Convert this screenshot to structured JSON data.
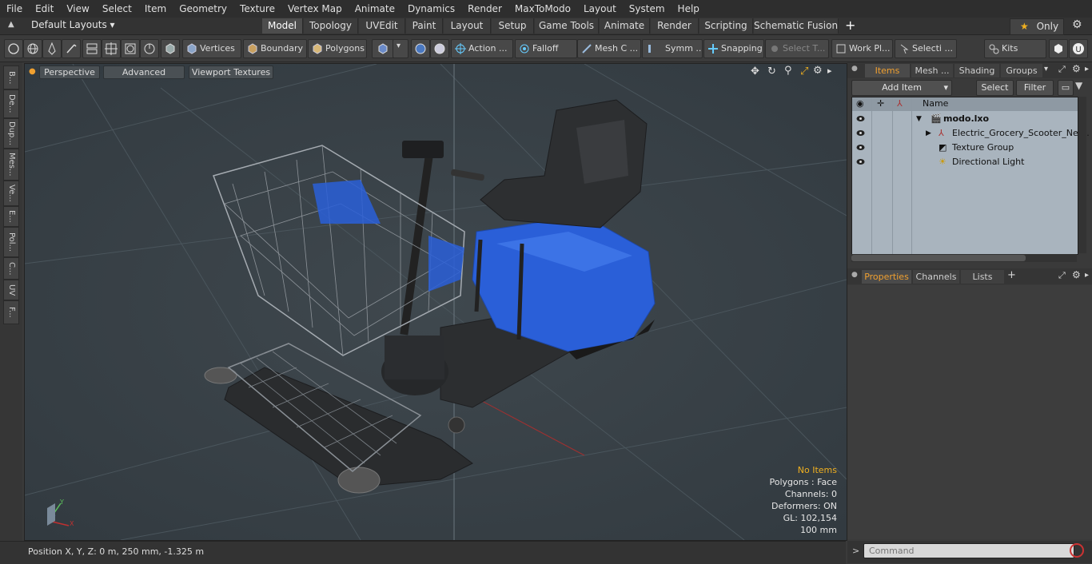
{
  "menu": [
    "File",
    "Edit",
    "View",
    "Select",
    "Item",
    "Geometry",
    "Texture",
    "Vertex Map",
    "Animate",
    "Dynamics",
    "Render",
    "MaxToModo",
    "Layout",
    "System",
    "Help"
  ],
  "layout": {
    "preset": "Default Layouts",
    "tabs": [
      "Model",
      "Topology",
      "UVEdit",
      "Paint",
      "Layout",
      "Setup",
      "Game Tools",
      "Animate",
      "Render",
      "Scripting",
      "Schematic Fusion"
    ],
    "active_tab": "Model",
    "add": "+",
    "only": "Only",
    "gear": "⚙"
  },
  "toolbar": {
    "vertices": "Vertices",
    "boundary": "Boundary",
    "polygons": "Polygons",
    "action": "Action",
    "falloff": "Falloff",
    "mesh": "Mesh C ...",
    "symm": "Symm ...",
    "snapping": "Snapping",
    "select_t": "Select T...",
    "work_pl": "Work Pl...",
    "selecti": "Selecti ...",
    "kits": "Kits"
  },
  "left_tabs": [
    "B...",
    "De...",
    "Dup...",
    "Mes...",
    "Ve...",
    "E...",
    "Pol...",
    "C...",
    "UV",
    "F..."
  ],
  "viewport": {
    "perspective": "Perspective",
    "advanced": "Advanced",
    "textures": "Viewport Textures",
    "stats": {
      "no_items": "No Items",
      "polygons": "Polygons : Face",
      "channels": "Channels: 0",
      "deformers": "Deformers: ON",
      "gl": "GL: 102,154",
      "scale": "100 mm"
    },
    "colors": {
      "seat_blue": "#2a5fd8",
      "accent": "#f0b020"
    }
  },
  "status": {
    "position": "Position X, Y, Z:   0 m, 250 mm, -1.325 m"
  },
  "items_panel": {
    "tabs": [
      "Items",
      "Mesh ...",
      "Shading",
      "Groups"
    ],
    "active_tab": "Items",
    "add_item": "Add Item",
    "select": "Select",
    "filter": "Filter",
    "col_name": "Name",
    "rows": [
      {
        "label": "modo.lxo"
      },
      {
        "label": "Electric_Grocery_Scooter_Ne ..."
      },
      {
        "label": "Texture Group"
      },
      {
        "label": "Directional Light"
      }
    ]
  },
  "props_panel": {
    "tabs": [
      "Properties",
      "Channels",
      "Lists"
    ],
    "active_tab": "Properties",
    "add": "+"
  },
  "command": {
    "placeholder": "Command",
    "prompt": ">"
  }
}
